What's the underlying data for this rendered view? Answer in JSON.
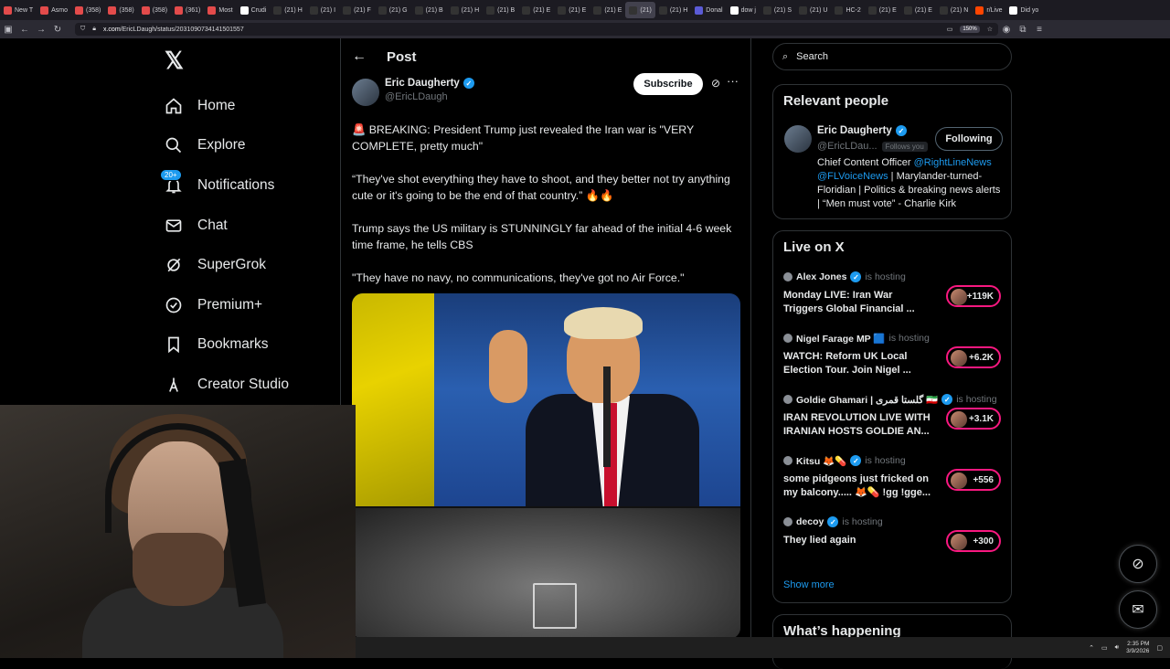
{
  "browser": {
    "tabs": [
      {
        "label": "New T",
        "color": "#e34b4b"
      },
      {
        "label": "Asmo",
        "color": "#e34b4b"
      },
      {
        "label": "(358)",
        "color": "#e34b4b"
      },
      {
        "label": "(358)",
        "color": "#e34b4b"
      },
      {
        "label": "(358)",
        "color": "#e34b4b"
      },
      {
        "label": "(361)",
        "color": "#e34b4b"
      },
      {
        "label": "Most",
        "color": "#e34b4b"
      },
      {
        "label": "Crudi",
        "color": "#ffffff"
      },
      {
        "label": "(21) H",
        "color": "#333333"
      },
      {
        "label": "(21) I",
        "color": "#333333"
      },
      {
        "label": "(21) F",
        "color": "#333333"
      },
      {
        "label": "(21) G",
        "color": "#333333"
      },
      {
        "label": "(21) B",
        "color": "#333333"
      },
      {
        "label": "(21) H",
        "color": "#333333"
      },
      {
        "label": "(21) B",
        "color": "#333333"
      },
      {
        "label": "(21) E",
        "color": "#333333"
      },
      {
        "label": "(21) E",
        "color": "#333333"
      },
      {
        "label": "(21) E",
        "color": "#333333"
      },
      {
        "label": "(21) ",
        "color": "#333333",
        "active": true
      },
      {
        "label": "(21) H",
        "color": "#333333"
      },
      {
        "label": "Donal",
        "color": "#5b5bd6"
      },
      {
        "label": "dow j",
        "color": "#ffffff"
      },
      {
        "label": "(21) S",
        "color": "#333333"
      },
      {
        "label": "(21) U",
        "color": "#333333"
      },
      {
        "label": "HC-2",
        "color": "#333333"
      },
      {
        "label": "(21) E",
        "color": "#333333"
      },
      {
        "label": "(21) E",
        "color": "#333333"
      },
      {
        "label": "(21) N",
        "color": "#333333"
      },
      {
        "label": "r/Live",
        "color": "#ff4500"
      },
      {
        "label": "Did yo",
        "color": "#ffffff"
      }
    ],
    "url_host": "x.com",
    "url_path": "/EricLDaugh/status/2031090734141501557",
    "zoom": "150%"
  },
  "leftnav": {
    "logo": "𝕏",
    "items": [
      {
        "label": "Home",
        "icon": "home-icon"
      },
      {
        "label": "Explore",
        "icon": "search-icon"
      },
      {
        "label": "Notifications",
        "icon": "bell-icon",
        "badge": "20+"
      },
      {
        "label": "Chat",
        "icon": "mail-icon"
      },
      {
        "label": "SuperGrok",
        "icon": "grok-icon"
      },
      {
        "label": "Premium+",
        "icon": "premium-icon"
      },
      {
        "label": "Bookmarks",
        "icon": "bookmark-icon"
      },
      {
        "label": "Creator Studio",
        "icon": "creator-icon"
      }
    ]
  },
  "post": {
    "header_title": "Post",
    "author_name": "Eric Daugherty",
    "author_handle": "@EricLDaugh",
    "subscribe_label": "Subscribe",
    "paragraphs": [
      "🚨 BREAKING: President Trump just revealed the Iran war is \"VERY COMPLETE, pretty much\"",
      "“They've shot everything they have to shoot, and they better not try anything cute or it's going to be the end of that country.” 🔥🔥",
      "Trump says the US military is STUNNINGLY far ahead of the initial 4-6 week time frame, he tells CBS",
      "\"They have no navy, no communications, they've got no Air Force.\""
    ]
  },
  "search": {
    "placeholder": "Search"
  },
  "relevant": {
    "title": "Relevant people",
    "name": "Eric Daugherty",
    "handle": "@EricLDau...",
    "follows_you": "Follows you",
    "following_label": "Following",
    "bio_1": "Chief Content Officer ",
    "bio_mention_1": "@RightLineNews",
    "bio_mention_2": "@FLVoiceNews",
    "bio_2": " | Marylander-turned-Floridian | Politics & breaking news alerts | “Men must vote” - Charlie Kirk"
  },
  "live": {
    "title": "Live on X",
    "hosting_text": "is hosting",
    "items": [
      {
        "host": "Alex Jones",
        "title": "Monday LIVE: Iran War Triggers Global Financial ...",
        "count": "+119K"
      },
      {
        "host": "Nigel Farage MP 🟦",
        "title": "WATCH: Reform UK Local Election Tour. Join Nigel ...",
        "count": "+6.2K"
      },
      {
        "host": "Goldie Ghamari | گلستا قمری 🇮🇷",
        "title": "IRAN REVOLUTION LIVE WITH IRANIAN HOSTS GOLDIE AN...",
        "count": "+3.1K"
      },
      {
        "host": "Kitsu 🦊💊",
        "title": "some pidgeons just fricked on my balcony..... 🦊💊 !gg !gge...",
        "count": "+556"
      },
      {
        "host": "decoy",
        "title": "They lied again",
        "count": "+300"
      }
    ],
    "show_more": "Show more"
  },
  "happening": {
    "title": "What’s happening"
  },
  "taskbar": {
    "time": "2:35 PM",
    "date": "3/9/2026"
  },
  "colors": {
    "accent": "#1d9bf0",
    "live": "#f91880",
    "background": "#000000"
  }
}
